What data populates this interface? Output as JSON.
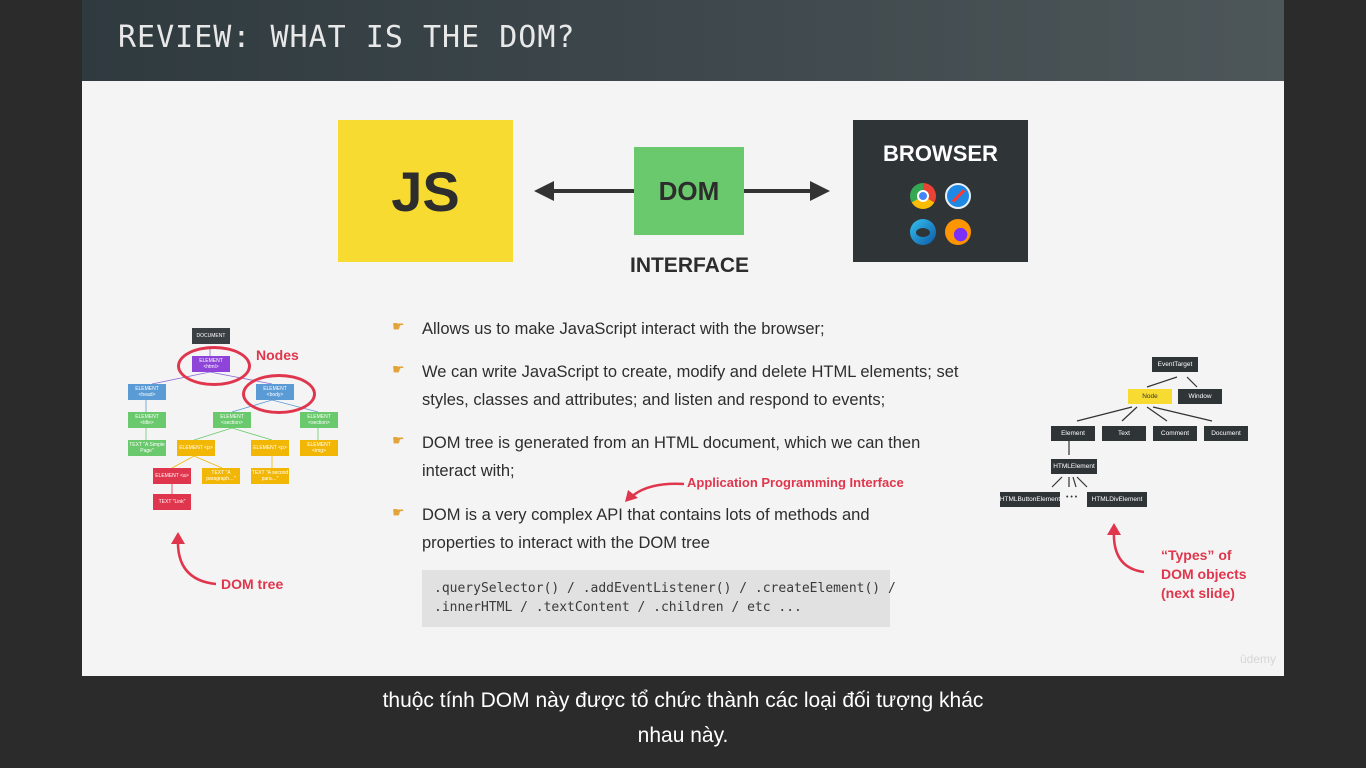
{
  "slide": {
    "title": "REVIEW: WHAT IS THE DOM?",
    "js_label": "JS",
    "dom_label": "DOM",
    "interface_label": "INTERFACE",
    "browser_label": "BROWSER",
    "browser_icons": [
      "chrome-icon",
      "safari-icon",
      "edge-icon",
      "firefox-icon"
    ],
    "bullets": [
      "Allows us to make JavaScript interact with the browser;",
      "We can write JavaScript to create, modify and delete HTML elements; set styles, classes and attributes; and listen and respond to events;",
      "DOM tree is generated from an HTML document, which we can then interact with;",
      "DOM is a very complex API that contains lots of methods and properties to interact with the DOM tree"
    ],
    "api_annotation": "Application Programming Interface",
    "code_lines": [
      ".querySelector() / .addEventListener() / .createElement() /",
      ".innerHTML / .textContent / .children / etc ..."
    ],
    "dom_tree_label": "DOM tree",
    "nodes_label": "Nodes",
    "types_label_lines": [
      "“Types” of",
      "DOM objects",
      "(next slide)"
    ],
    "watermark": "ûdemy",
    "colors": {
      "js": "#f7db30",
      "dom": "#69c96c",
      "browser": "#2f3437",
      "accent": "#e0364d"
    }
  },
  "left_tree": {
    "document": "DOCUMENT",
    "html": "ELEMENT <html>",
    "head": "ELEMENT <head>",
    "body": "ELEMENT <body>",
    "title": "ELEMENT <title>",
    "section1": "ELEMENT <section>",
    "section2": "ELEMENT <section>",
    "title_text": "TEXT \"A Simple Page\"",
    "p1": "ELEMENT <p>",
    "p2": "ELEMENT <p>",
    "img": "ELEMENT <img>",
    "a": "ELEMENT <a>",
    "p1_text": "TEXT \"A paragraph…\"",
    "p2_text": "TEXT \"A second para…\"",
    "link_text": "TEXT \"Link\""
  },
  "right_tree": {
    "event_target": "EventTarget",
    "node": "Node",
    "window": "Window",
    "element": "Element",
    "text": "Text",
    "comment": "Comment",
    "document": "Document",
    "html_element": "HTMLElement",
    "button_element": "HTMLButtonElement",
    "ellipsis": "• • •",
    "div_element": "HTMLDivElement"
  },
  "subtitle_lines": [
    "thuộc tính DOM này được tổ chức thành các loại đối tượng khác",
    "nhau này."
  ]
}
